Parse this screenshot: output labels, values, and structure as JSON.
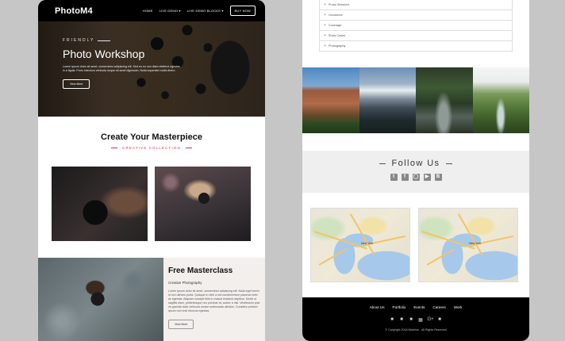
{
  "left": {
    "nav": {
      "logo": "PhotoM4",
      "links": [
        "HOME",
        "LIVE DEMO ▾",
        "LIVE DEMO BLOCKS ▾"
      ],
      "button": "BUY NOW"
    },
    "hero": {
      "eyebrow": "FRIENDLY",
      "title": "Photo Workshop",
      "text": "Lorem ipsum dolor sit amet, consectetur adipiscing elit. Sed eu eu non diam eleifend egestas in a figula. Proin interdum vehicula neque sit amet dignissim. Nulla imperdiet mollis libero.",
      "button": "View More"
    },
    "masterpiece": {
      "title": "Create Your Masterpiece",
      "subtitle": "CREATIVE COLLECTION"
    },
    "masterclass": {
      "title": "Free Masterclass",
      "subtitle": "Creative Photography",
      "text": "Lorem ipsum dolor sit amet, consectetur adipiscing elit. Nulla eget lorem id orci ultrices porta. Quisque in nibh a nisi condimentum placerat enim ac egestas. Aliquam suscipit felis in massa tincidunt dapibus. Morbi ut sagittis diam, pellentesque nec pulvinar at, auctor a nisl. Vestibulum quis mi gravida dolor vehicula ornare malesuada ultricies. Curabitur pretium ipsum non erat rhoncus egestas.",
      "button": "View More"
    }
  },
  "right": {
    "list": [
      "Photo Sessions",
      "Occasions",
      "Coverage",
      "Show Cases",
      "Photography"
    ],
    "follow": {
      "title": "Follow Us",
      "icons": [
        "twitter-icon",
        "facebook-icon",
        "instagram-icon",
        "youtube-icon",
        "behance-icon"
      ]
    },
    "maps": [
      {
        "city": "New York"
      },
      {
        "city": "New York"
      }
    ],
    "footer": {
      "links": [
        "About Us",
        "Portfolio",
        "Events",
        "Careers",
        "Work"
      ],
      "icons": [
        "twitter-icon",
        "facebook-icon",
        "youtube-icon",
        "instagram-icon",
        "google-plus-icon",
        "behance-icon"
      ],
      "copyright": "© Copyright 2018 Mobirise - All Rights Reserved"
    }
  }
}
